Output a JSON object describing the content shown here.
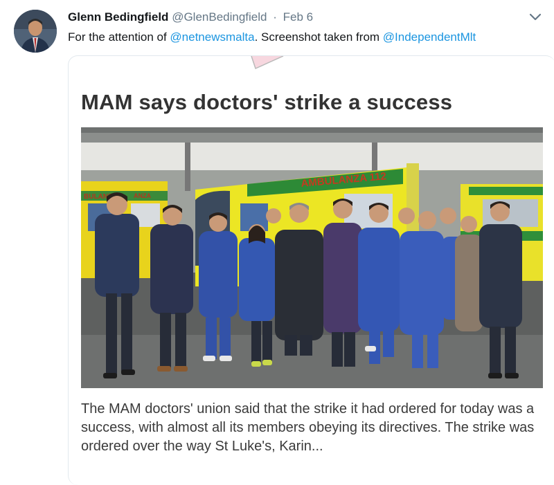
{
  "tweet": {
    "author_name": "Glenn Bedingfield",
    "author_handle": "@GlenBedingfield",
    "separator": "·",
    "date": "Feb 6",
    "text": {
      "part1": "For the attention of ",
      "mention1": "@netnewsmalta",
      "part2": ". Screenshot taken from ",
      "mention2": "@IndependentMlt"
    },
    "caret_icon": "chevron-down-icon"
  },
  "card": {
    "headline": "MAM says doctors' strike a success",
    "photo_description_icon": "photo",
    "ambulance_labels": {
      "center": "AMBULANZA 112",
      "left": "BULANZA",
      "left2": "ANZA"
    },
    "body": "The MAM doctors' union said that the strike it had ordered for today was a success, with almost all its members obeying its directives. The strike was ordered over the way St Luke's, Karin..."
  },
  "colors": {
    "mention": "#1b95e0",
    "text": "#14171a",
    "muted": "#657786",
    "ambulance_yellow": "#e6e21f",
    "ambulance_green": "#2f8f3a",
    "scrubs_blue": "#2f4ea3"
  }
}
